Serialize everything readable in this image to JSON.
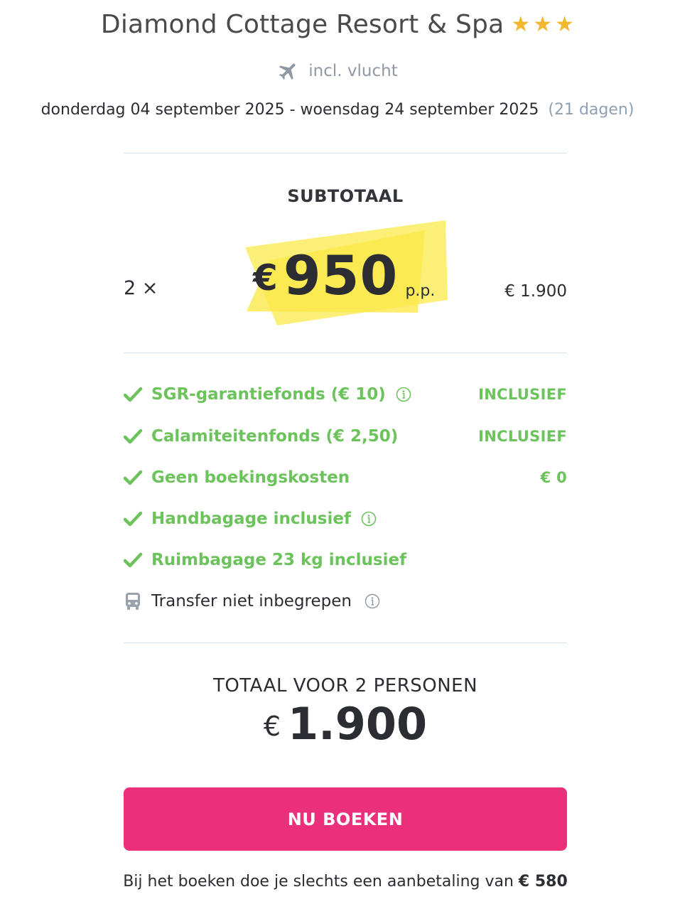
{
  "hotel": {
    "name": "Diamond Cottage Resort & Spa",
    "stars": 3,
    "star_color": "#f2b830"
  },
  "flight": {
    "icon": "plane-icon",
    "label": "incl. vlucht"
  },
  "dates": {
    "range": "donderdag 04 september 2025 - woensdag 24 september 2025",
    "duration": "(21 dagen)"
  },
  "subtotal": {
    "label": "SUBTOTAAL",
    "quantity": "2 ×",
    "currency": "€",
    "price": "950",
    "per_person": "p.p.",
    "line_total": "€ 1.900",
    "highlight_color": "#fbe94a"
  },
  "features": [
    {
      "icon": "check-icon",
      "label": "SGR-garantiefonds  (€ 10)",
      "info": true,
      "value": "INCLUSIEF",
      "status": "included"
    },
    {
      "icon": "check-icon",
      "label": "Calamiteitenfonds  (€ 2,50)",
      "info": false,
      "value": "INCLUSIEF",
      "status": "included"
    },
    {
      "icon": "check-icon",
      "label": "Geen boekingskosten",
      "info": false,
      "value": "€ 0",
      "status": "included"
    },
    {
      "icon": "check-icon",
      "label": "Handbagage inclusief",
      "info": true,
      "value": "",
      "status": "included"
    },
    {
      "icon": "check-icon",
      "label": "Ruimbagage 23 kg inclusief",
      "info": false,
      "value": "",
      "status": "included"
    },
    {
      "icon": "bus-icon",
      "label": "Transfer niet inbegrepen",
      "info": true,
      "value": "",
      "status": "not-included"
    }
  ],
  "total": {
    "label": "TOTAAL VOOR 2 PERSONEN",
    "currency": "€",
    "amount": "1.900"
  },
  "book_button": {
    "label": "NU BOEKEN",
    "color": "#ec2f7a"
  },
  "deposit": {
    "text": "Bij het boeken doe je slechts een aanbetaling van ",
    "amount": "€ 580"
  },
  "colors": {
    "green": "#6cc35c",
    "grey_text": "#8f98a3",
    "dark_text": "#2b2d33"
  }
}
